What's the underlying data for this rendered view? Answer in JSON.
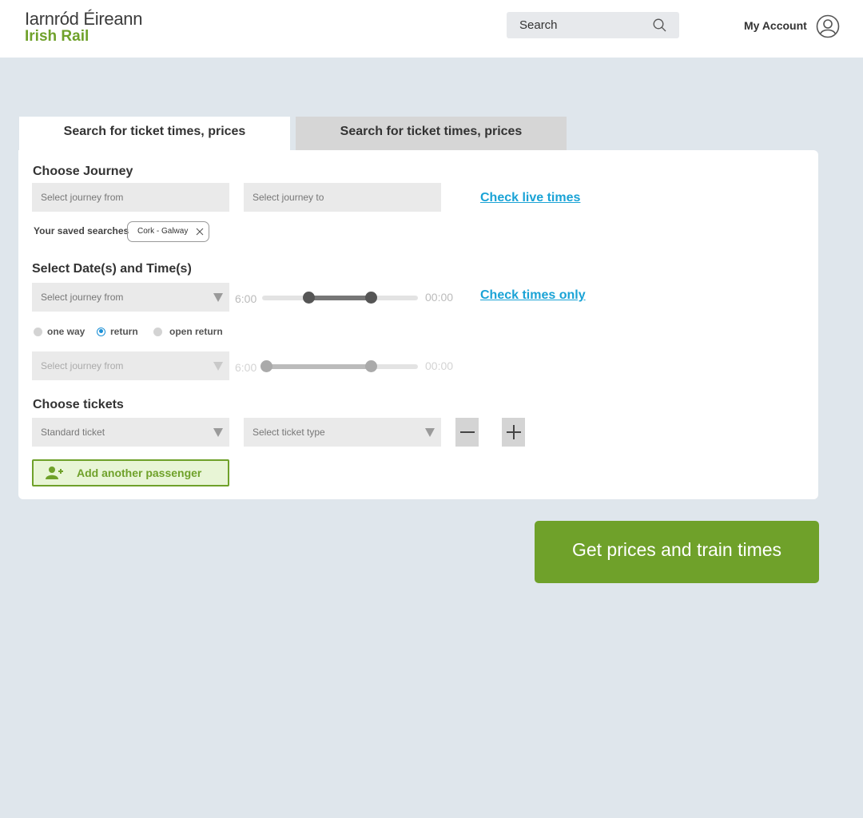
{
  "header": {
    "logo_line1": "Iarnród Éireann",
    "logo_line2": "Irish Rail",
    "search_placeholder": "Search",
    "account_label": "My Account"
  },
  "tabs": [
    {
      "label": "Search for ticket times, prices",
      "active": true
    },
    {
      "label": "Search for ticket times, prices",
      "active": false
    }
  ],
  "journey": {
    "title": "Choose Journey",
    "from_placeholder": "Select journey from",
    "to_placeholder": "Select journey to",
    "live_times_link": "Check live times",
    "saved_label": "Your saved searches",
    "saved_chip": "Cork - Galway"
  },
  "datetime": {
    "title": "Select Date(s) and Time(s)",
    "outbound_select": "Select journey from",
    "outbound_start_time": "6:00",
    "outbound_end_time": "00:00",
    "outbound_range": [
      0.3,
      0.7
    ],
    "check_times_link": "Check times only",
    "trip_options": [
      "one way",
      "return",
      "open return"
    ],
    "selected_trip": "return",
    "return_select": "Select journey from",
    "return_start_time": "6:00",
    "return_end_time": "00:00",
    "return_range": [
      0.03,
      0.7
    ]
  },
  "tickets": {
    "title": "Choose tickets",
    "ticket_class": "Standard ticket",
    "ticket_type_placeholder": "Select ticket type",
    "add_passenger": "Add another passenger"
  },
  "cta_label": "Get prices and train times",
  "colors": {
    "brand_green": "#6fa12a",
    "link_blue": "#1aa3d6",
    "page_bg": "#dfe6ec"
  }
}
